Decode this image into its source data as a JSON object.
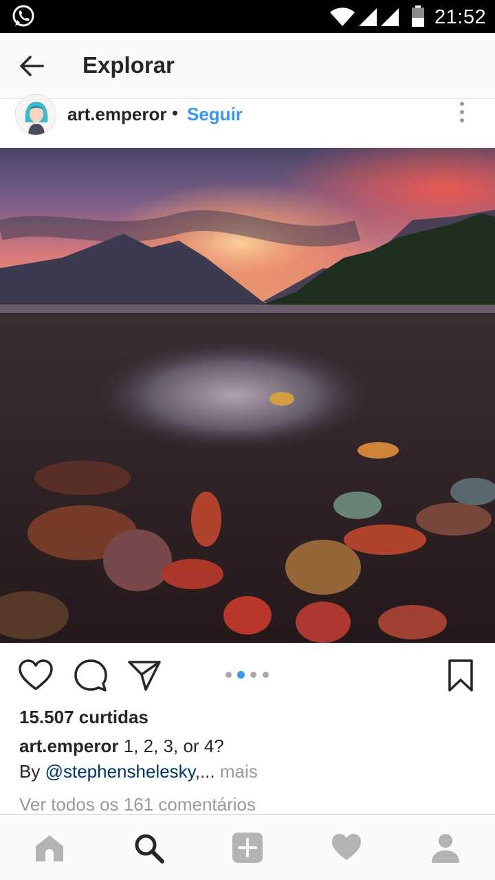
{
  "status_bar": {
    "time": "21:52",
    "icons": [
      "whatsapp-icon",
      "wifi-icon",
      "signal-icon",
      "signal-icon",
      "battery-icon"
    ]
  },
  "app_bar": {
    "back_icon": "arrow-left-icon",
    "title": "Explorar"
  },
  "post": {
    "username": "art.emperor",
    "separator": "•",
    "follow_label": "Seguir",
    "more_icon": "vertical-dots-icon",
    "carousel": {
      "count": 4,
      "active_index": 1
    },
    "likes_text": "15.507 curtidas",
    "caption_user": "art.emperor",
    "caption_text": " 1, 2, 3, or 4?",
    "caption_by": "By ",
    "caption_mention": "@stephenshelesky",
    "caption_ellipsis": ",...",
    "more_label": " mais",
    "view_comments": "Ver todos os 161 comentários"
  },
  "colors": {
    "accent_blue": "#3897f0",
    "mention": "#003569",
    "muted": "#999999",
    "text": "#262626"
  },
  "bottom_nav": {
    "items": [
      "home-icon",
      "search-icon",
      "add-icon",
      "heart-icon",
      "profile-icon"
    ],
    "active": "search-icon"
  }
}
